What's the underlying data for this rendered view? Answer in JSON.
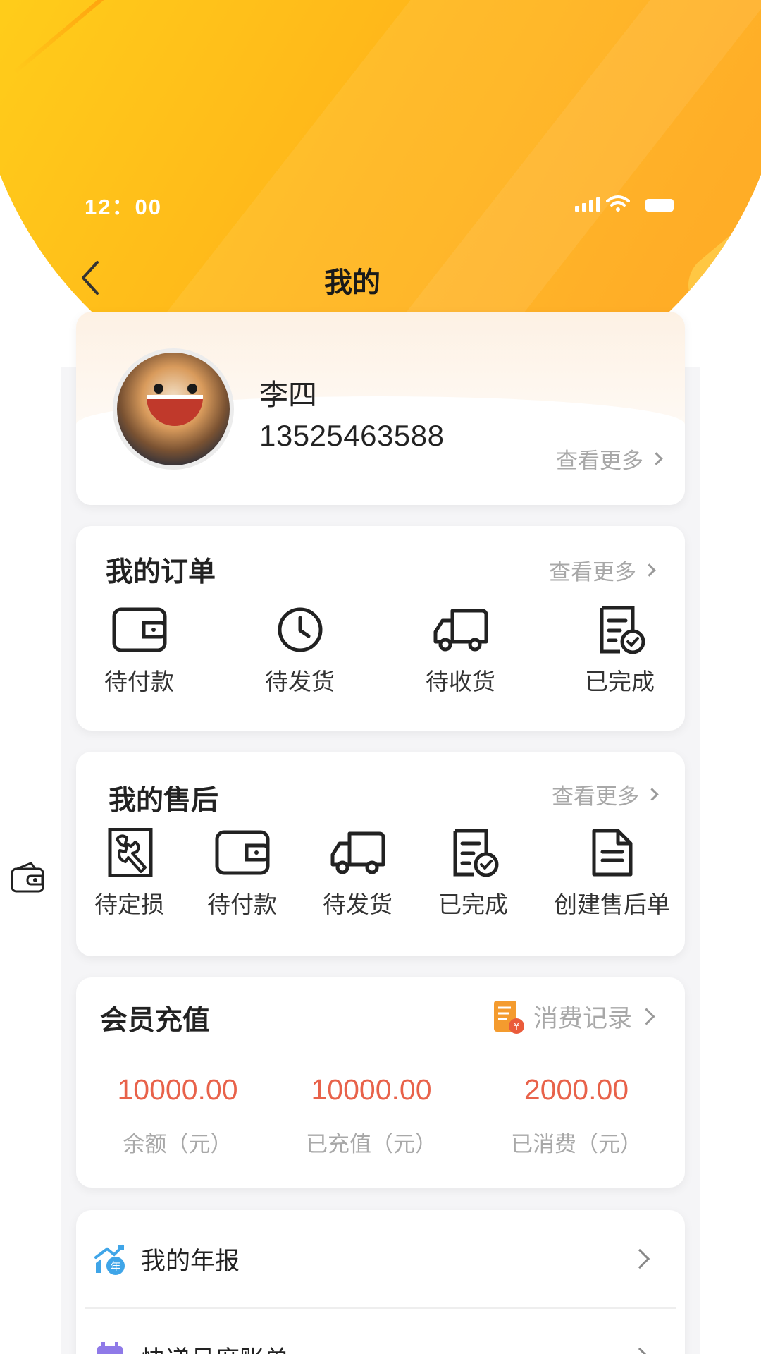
{
  "status_bar": {
    "time": "12：00"
  },
  "nav": {
    "title": "我的"
  },
  "profile": {
    "name": "李四",
    "phone": "13525463588",
    "more_label": "查看更多"
  },
  "orders": {
    "title": "我的订单",
    "more_label": "查看更多",
    "items": [
      {
        "label": "待付款",
        "icon": "wallet-icon"
      },
      {
        "label": "待发货",
        "icon": "clock-icon"
      },
      {
        "label": "待收货",
        "icon": "truck-icon"
      },
      {
        "label": "已完成",
        "icon": "completed-doc-icon"
      }
    ]
  },
  "after_sales": {
    "title": "我的售后",
    "more_label": "查看更多",
    "items": [
      {
        "label": "待定损",
        "icon": "wrench-icon"
      },
      {
        "label": "待付款",
        "icon": "wallet-icon"
      },
      {
        "label": "待发货",
        "icon": "truck-icon"
      },
      {
        "label": "已完成",
        "icon": "completed-doc-icon"
      },
      {
        "label": "创建售后单",
        "icon": "document-icon"
      }
    ]
  },
  "membership": {
    "title": "会员充值",
    "records_label": "消费记录",
    "stats": [
      {
        "value": "10000.00",
        "label": "余额（元）"
      },
      {
        "value": "10000.00",
        "label": "已充值（元）"
      },
      {
        "value": "2000.00",
        "label": "已消费（元）"
      }
    ],
    "accent_color": "#e8624a"
  },
  "menu": {
    "items": [
      {
        "label": "我的年报",
        "icon": "annual-report-icon"
      },
      {
        "label": "快递月度账单",
        "icon": "monthly-bill-icon"
      }
    ]
  },
  "colors": {
    "hero_start": "#ffd21a",
    "hero_end": "#ff9f12"
  }
}
